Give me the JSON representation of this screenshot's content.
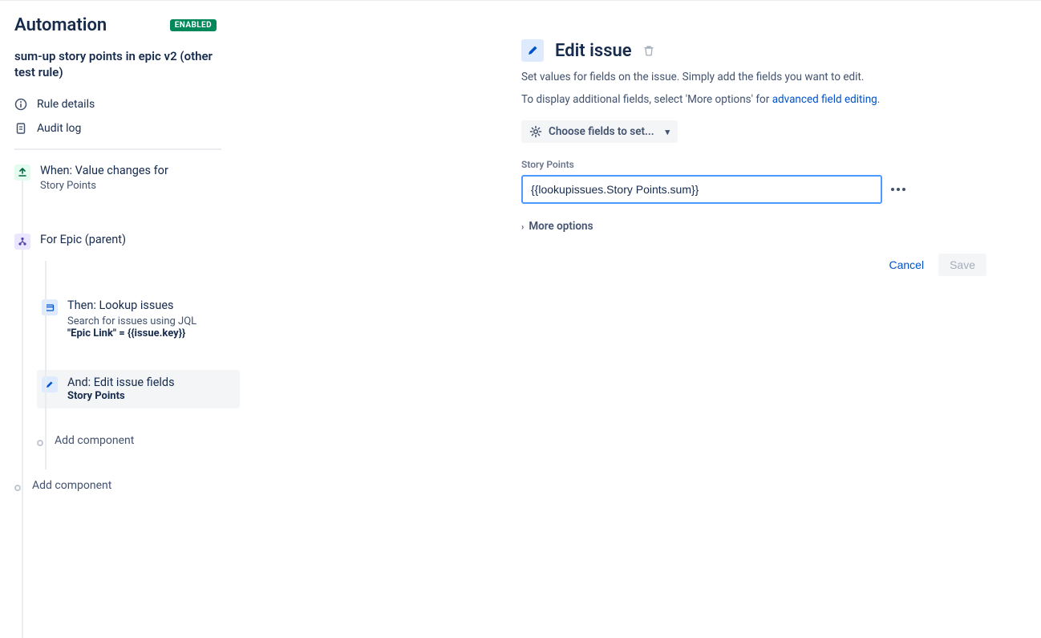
{
  "header": {
    "title": "Automation",
    "status": "ENABLED"
  },
  "rule": {
    "name": "sum-up story points in epic v2 (other test rule)",
    "meta": {
      "details": "Rule details",
      "audit": "Audit log"
    }
  },
  "tree": {
    "trigger": {
      "title": "When: Value changes for",
      "sub": "Story Points"
    },
    "branch": {
      "title": "For Epic (parent)"
    },
    "action_lookup": {
      "title": "Then: Lookup issues",
      "sub": "Search for issues using JQL",
      "jql": "\"Epic Link\" = {{issue.key}}"
    },
    "action_edit": {
      "title": "And: Edit issue fields",
      "field": "Story Points"
    },
    "add_component": "Add component"
  },
  "panel": {
    "title": "Edit issue",
    "desc1": "Set values for fields on the issue. Simply add the fields you want to edit.",
    "desc2_pre": "To display additional fields, select 'More options' for ",
    "desc2_link": "advanced field editing",
    "choose_label": "Choose fields to set...",
    "field_label": "Story Points",
    "field_value": "{{lookupissues.Story Points.sum}}",
    "more_options": "More options",
    "cancel": "Cancel",
    "save": "Save"
  }
}
